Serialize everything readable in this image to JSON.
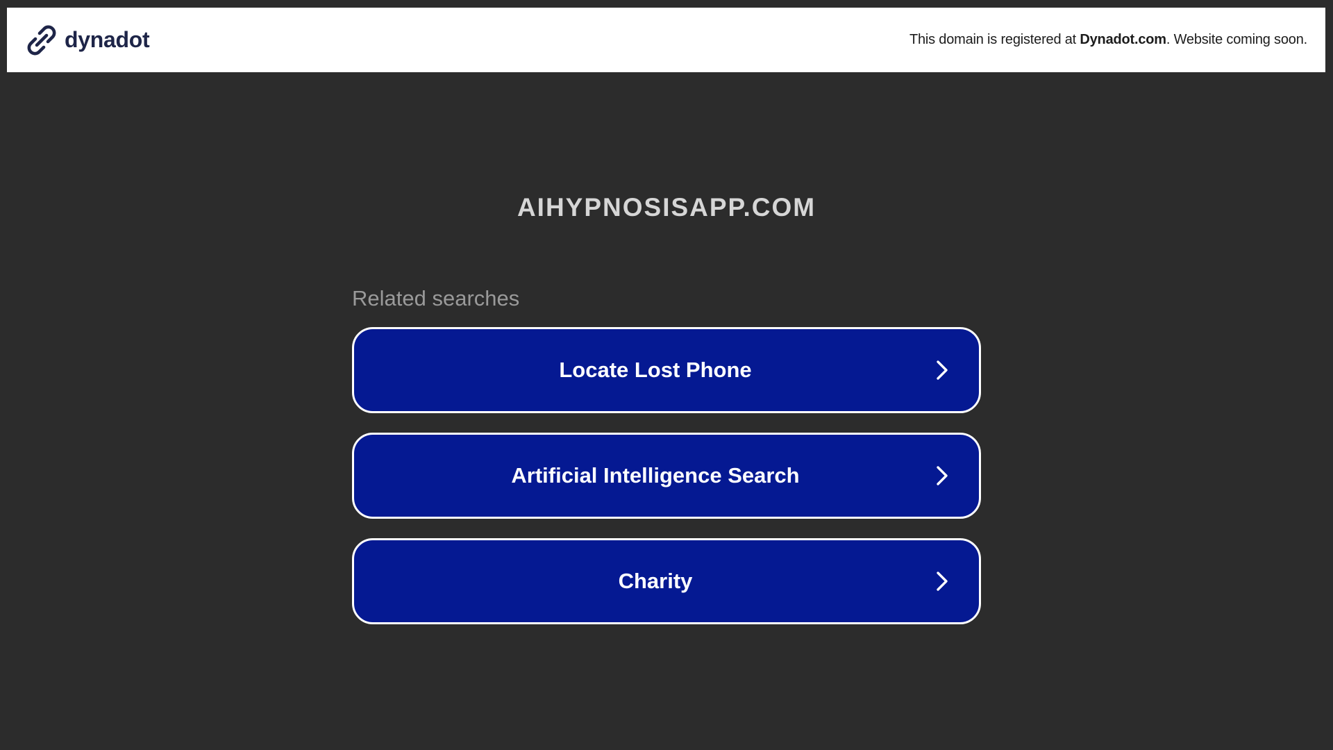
{
  "header": {
    "brand_name": "dynadot",
    "notice_prefix": "This domain is registered at ",
    "notice_strong": "Dynadot.com",
    "notice_suffix": ". Website coming soon.",
    "brand_icon": "dynadot-logo-icon"
  },
  "main": {
    "domain": "AIHYPNOSISAPP.COM",
    "related_heading": "Related searches",
    "searches": [
      {
        "label": "Locate Lost Phone",
        "icon": "chevron-right-icon"
      },
      {
        "label": "Artificial Intelligence Search",
        "icon": "chevron-right-icon"
      },
      {
        "label": "Charity",
        "icon": "chevron-right-icon"
      }
    ]
  },
  "colors": {
    "background": "#2c2c2c",
    "topbar": "#ffffff",
    "button": "#051992",
    "button_border": "#ffffff",
    "brand_text": "#1e2548",
    "domain_text": "#d6d6d6",
    "heading_text": "#9a9a9a"
  }
}
